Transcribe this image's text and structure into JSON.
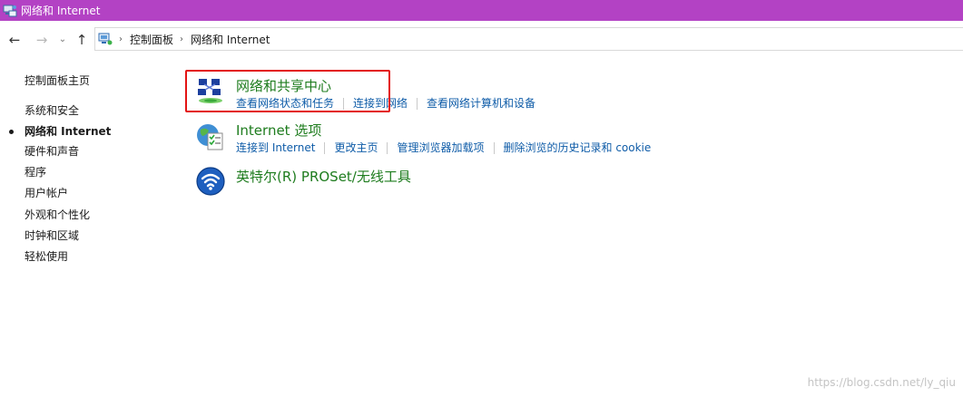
{
  "window": {
    "title": "网络和 Internet",
    "icon": "network-icon",
    "accent_color": "#b342c4"
  },
  "nav": {
    "back_icon": "arrow-left-icon",
    "forward_icon": "arrow-right-icon",
    "recent_icon": "chevron-down-icon",
    "up_icon": "arrow-up-icon",
    "back_glyph": "←",
    "forward_glyph": "→",
    "recent_glyph": "⌄",
    "up_glyph": "↑"
  },
  "address": {
    "breadcrumbs": [
      "控制面板",
      "网络和 Internet"
    ],
    "separator": "›"
  },
  "sidebar": {
    "items": [
      {
        "label": "控制面板主页",
        "current": false
      },
      {
        "label": "系统和安全",
        "current": false
      },
      {
        "label": "网络和 Internet",
        "current": true
      },
      {
        "label": "硬件和声音",
        "current": false
      },
      {
        "label": "程序",
        "current": false
      },
      {
        "label": "用户帐户",
        "current": false
      },
      {
        "label": "外观和个性化",
        "current": false
      },
      {
        "label": "时钟和区域",
        "current": false
      },
      {
        "label": "轻松使用",
        "current": false
      }
    ]
  },
  "categories": [
    {
      "title": "网络和共享中心",
      "icon": "network-sharing-center-icon",
      "links": [
        "查看网络状态和任务",
        "连接到网络",
        "查看网络计算机和设备"
      ]
    },
    {
      "title": "Internet 选项",
      "icon": "internet-options-icon",
      "links": [
        "连接到 Internet",
        "更改主页",
        "管理浏览器加载项",
        "删除浏览的历史记录和 cookie"
      ]
    },
    {
      "title": "英特尔(R) PROSet/无线工具",
      "icon": "intel-wireless-icon",
      "links": []
    }
  ],
  "colors": {
    "title_green": "#1e7c1e",
    "link_blue": "#0f5ca8",
    "highlight_red": "#e31414"
  },
  "watermark": "https://blog.csdn.net/ly_qiu"
}
